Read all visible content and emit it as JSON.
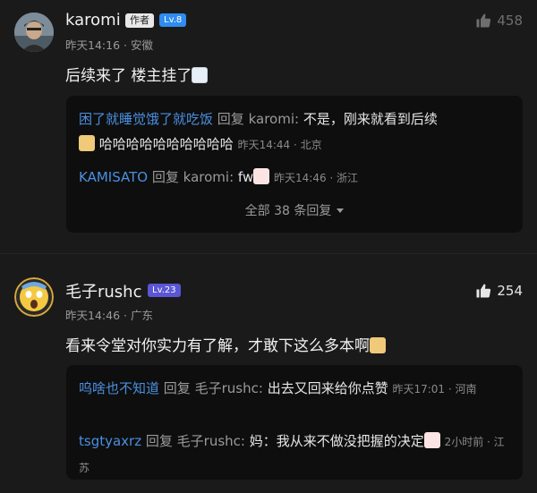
{
  "post1": {
    "username": "karomi",
    "author_badge": "作者",
    "level_badge": "Lv.8",
    "meta": "昨天14:16 · 安徽",
    "likes": "458",
    "content": "后续来了 楼主挂了",
    "replies": [
      {
        "name": "困了就睡觉饿了就吃饭",
        "reply_word": "回复",
        "target": "karomi",
        "text": "不是，刚来就看到后续",
        "text2": "哈哈哈哈哈哈哈哈哈哈",
        "time": "昨天14:44 · 北京"
      },
      {
        "name": "KAMISATO",
        "reply_word": "回复",
        "target": "karomi",
        "text": "fw",
        "time": "昨天14:46 · 浙江"
      }
    ],
    "more_replies": "全部 38 条回复"
  },
  "post2": {
    "username": "毛子rushc",
    "level_badge": "Lv.23",
    "meta": "昨天14:46 · 广东",
    "likes": "254",
    "content": "看来令堂对你实力有了解，才敢下这么多本啊",
    "replies": [
      {
        "name": "呜啥也不知道",
        "reply_word": "回复",
        "target": "毛子rushc",
        "text": "出去又回来给你点赞",
        "time": "昨天17:01 · 河南"
      },
      {
        "name": "tsgtyaxrz",
        "reply_word": "回复",
        "target": "毛子rushc",
        "text": "妈：我从来不做没把握的决定",
        "time": "2小时前 · 江苏"
      }
    ]
  },
  "colors": {
    "accent_blue": "#4a8fe0",
    "level_blue": "#2f8cf0",
    "level_purple": "#5a56d6"
  }
}
